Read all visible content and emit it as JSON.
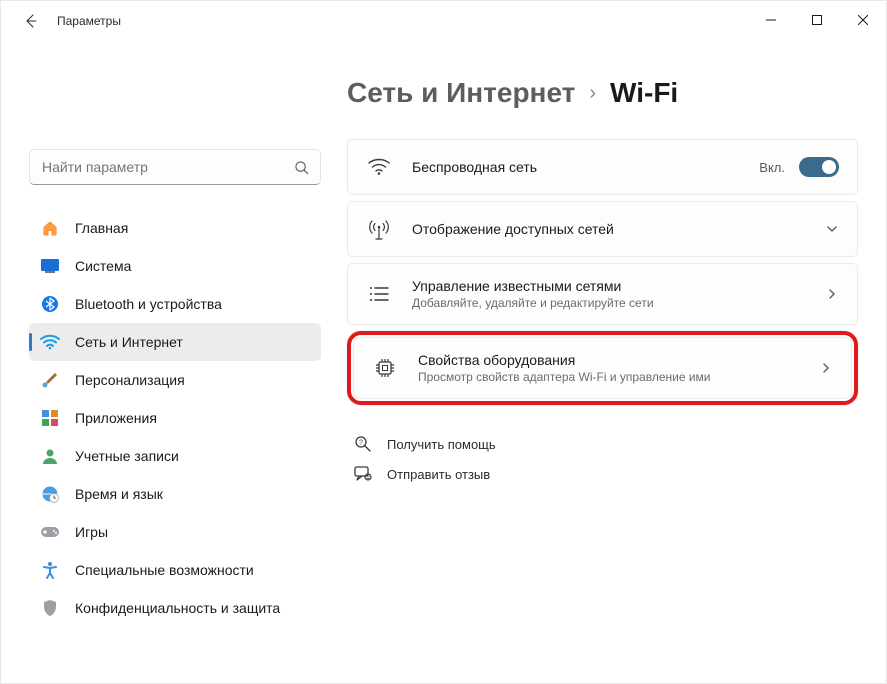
{
  "window": {
    "title": "Параметры"
  },
  "search": {
    "placeholder": "Найти параметр"
  },
  "sidebar": {
    "items": [
      {
        "label": "Главная"
      },
      {
        "label": "Система"
      },
      {
        "label": "Bluetooth и устройства"
      },
      {
        "label": "Сеть и Интернет"
      },
      {
        "label": "Персонализация"
      },
      {
        "label": "Приложения"
      },
      {
        "label": "Учетные записи"
      },
      {
        "label": "Время и язык"
      },
      {
        "label": "Игры"
      },
      {
        "label": "Специальные возможности"
      },
      {
        "label": "Конфиденциальность и защита"
      }
    ]
  },
  "breadcrumb": {
    "parent": "Сеть и Интернет",
    "current": "Wi-Fi"
  },
  "cards": {
    "wireless": {
      "title": "Беспроводная сеть",
      "state": "Вкл."
    },
    "available": {
      "title": "Отображение доступных сетей"
    },
    "known": {
      "title": "Управление известными сетями",
      "sub": "Добавляйте, удаляйте и редактируйте сети"
    },
    "hardware": {
      "title": "Свойства оборудования",
      "sub": "Просмотр свойств адаптера Wi-Fi и управление ими"
    }
  },
  "links": {
    "help": "Получить помощь",
    "feedback": "Отправить отзыв"
  }
}
